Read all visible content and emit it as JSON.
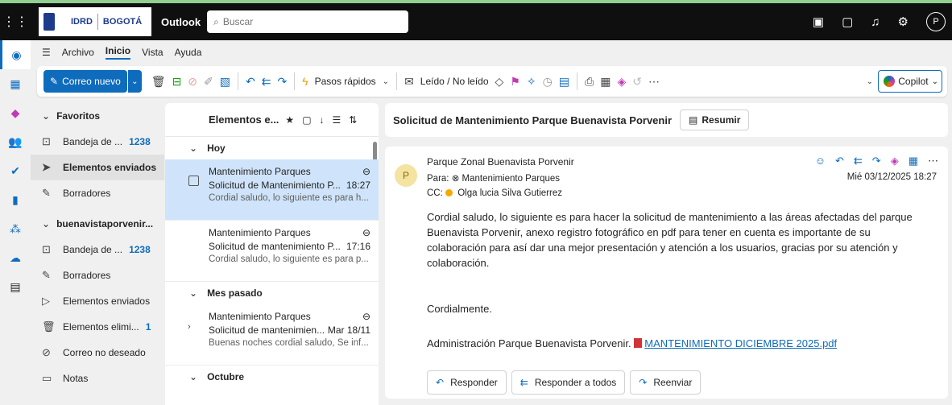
{
  "header": {
    "logo_idrd": "IDRD",
    "logo_bogota": "BOGOTÁ",
    "app_name": "Outlook",
    "search_placeholder": "Buscar",
    "user_initial": "P"
  },
  "menu": {
    "items": [
      "Archivo",
      "Inicio",
      "Vista",
      "Ayuda"
    ],
    "active": "Inicio"
  },
  "ribbon": {
    "new_mail": "Correo nuevo",
    "quick_steps": "Pasos rápidos",
    "read_unread": "Leído / No leído",
    "copilot": "Copilot"
  },
  "folders": {
    "favorites_label": "Favoritos",
    "favorites": [
      {
        "label": "Bandeja de ...",
        "count": "1238",
        "icon": "inbox-icon"
      },
      {
        "label": "Elementos enviados",
        "count": "",
        "icon": "send-icon"
      },
      {
        "label": "Borradores",
        "count": "",
        "icon": "drafts-icon"
      }
    ],
    "account_label": "buenavistaporvenir...",
    "account": [
      {
        "label": "Bandeja de ...",
        "count": "1238",
        "icon": "inbox-icon"
      },
      {
        "label": "Borradores",
        "count": "",
        "icon": "drafts-icon"
      },
      {
        "label": "Elementos enviados",
        "count": "",
        "icon": "send-icon"
      },
      {
        "label": "Elementos elimi...",
        "count": "1",
        "icon": "trash-icon"
      },
      {
        "label": "Correo no deseado",
        "count": "",
        "icon": "junk-icon"
      },
      {
        "label": "Notas",
        "count": "",
        "icon": "notes-icon"
      }
    ]
  },
  "message_list": {
    "title": "Elementos e...",
    "groups": [
      {
        "label": "Hoy",
        "items": [
          {
            "sender": "Mantenimiento Parques",
            "subject": "Solicitud de Mantenimiento P...",
            "time": "18:27",
            "preview": "Cordial saludo, lo siguiente es para h..."
          },
          {
            "sender": "Mantenimiento Parques",
            "subject": "Solicitud de mantenimiento P...",
            "time": "17:16",
            "preview": "Cordial saludo, lo siguiente es para p..."
          }
        ]
      },
      {
        "label": "Mes pasado",
        "items": [
          {
            "sender": "Mantenimiento Parques",
            "subject": "Solicitud de mantenimien...",
            "time": "Mar 18/11",
            "preview": "Buenas noches cordial saludo, Se inf..."
          }
        ]
      },
      {
        "label": "Octubre",
        "items": []
      }
    ]
  },
  "reading": {
    "subject": "Solicitud de Mantenimiento Parque Buenavista Porvenir",
    "summarize": "Resumir",
    "avatar_initial": "P",
    "from": "Parque Zonal Buenavista Porvenir",
    "to_label": "Para:",
    "to": "Mantenimiento Parques",
    "date": "Mié 03/12/2025 18:27",
    "cc_label": "CC:",
    "cc": "Olga lucia Silva Gutierrez",
    "body": "Cordial saludo, lo siguiente es para hacer la solicitud de mantenimiento a las áreas afectadas del parque Buenavista Porvenir, anexo registro fotográfico en pdf  para tener en cuenta es importante de su colaboración para así dar una mejor presentación y atención a los usuarios, gracias por su atención y colaboración.",
    "closing": "Cordialmente.",
    "signature": "Administración Parque Buenavista Porvenir.",
    "attachment": "MANTENIMIENTO DICIEMBRE 2025.pdf",
    "reply": "Responder",
    "reply_all": "Responder a todos",
    "forward": "Reenviar"
  }
}
